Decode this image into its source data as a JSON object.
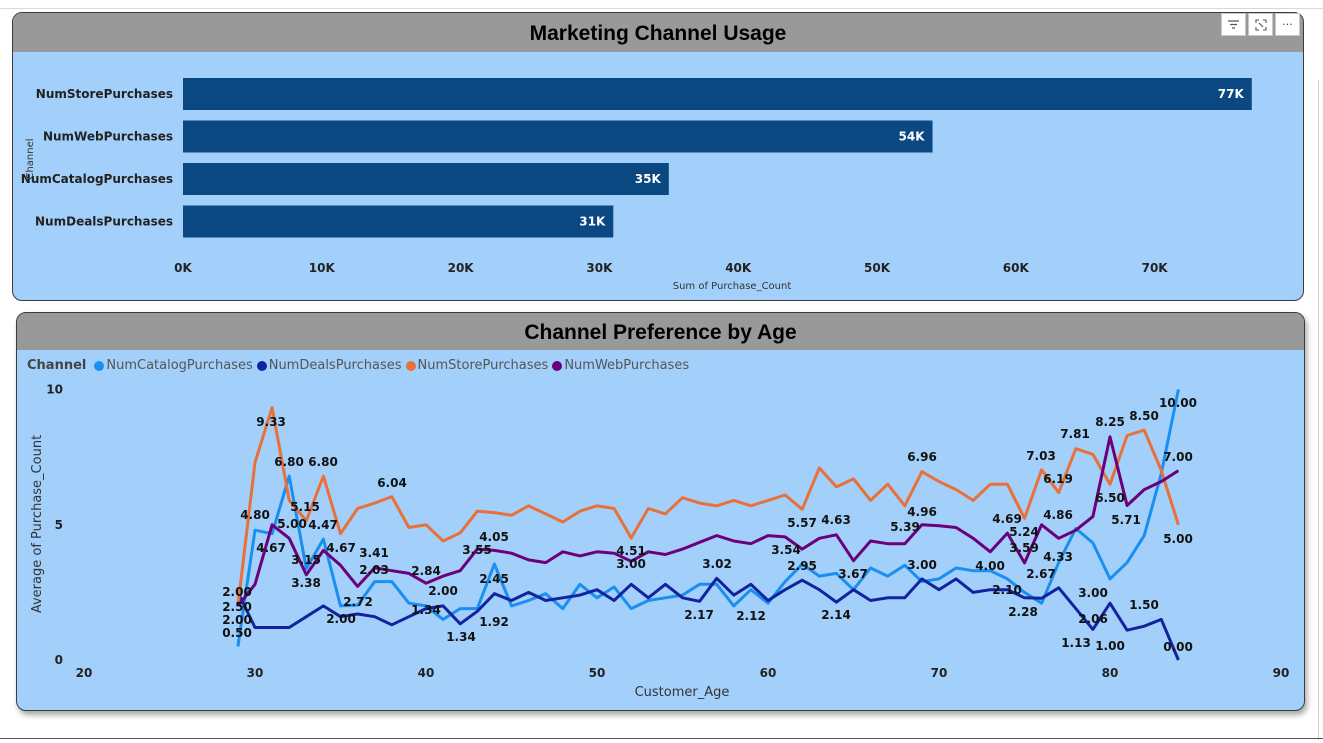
{
  "toolbar": {
    "filter_icon": "filter-icon",
    "focus_icon": "focus-mode-icon",
    "more_icon": "more-options-icon",
    "more_label": "···"
  },
  "colors": {
    "panel_bg": "#a3d0fb",
    "title_bar": "#999999",
    "bar": "#0b4780",
    "catalog": "#1a8ff0",
    "deals": "#12239e",
    "store": "#e8703a",
    "web": "#6b007b"
  },
  "chart_data": [
    {
      "type": "bar",
      "orientation": "horizontal",
      "title": "Marketing Channel Usage",
      "xlabel": "Sum of Purchase_Count",
      "ylabel": "Channel",
      "categories": [
        "NumStorePurchases",
        "NumWebPurchases",
        "NumCatalogPurchases",
        "NumDealsPurchases"
      ],
      "values": [
        77000,
        54000,
        35000,
        31000
      ],
      "data_labels": [
        "77K",
        "54K",
        "35K",
        "31K"
      ],
      "xlim": [
        0,
        77000
      ],
      "x_ticks": [
        0,
        10000,
        20000,
        30000,
        40000,
        50000,
        60000,
        70000
      ],
      "x_tick_labels": [
        "0K",
        "10K",
        "20K",
        "30K",
        "40K",
        "50K",
        "60K",
        "70K"
      ]
    },
    {
      "type": "line",
      "title": "Channel Preference by Age",
      "xlabel": "Customer_Age",
      "ylabel": "Average of Purchase_Count",
      "legend_title": "Channel",
      "xlim": [
        20,
        90
      ],
      "ylim": [
        0,
        10
      ],
      "x_ticks": [
        20,
        30,
        40,
        50,
        60,
        70,
        80,
        90
      ],
      "y_ticks": [
        0,
        5,
        10
      ],
      "x": [
        29,
        30,
        31,
        32,
        33,
        34,
        35,
        36,
        37,
        38,
        39,
        40,
        41,
        42,
        43,
        44,
        45,
        46,
        47,
        48,
        49,
        50,
        51,
        52,
        53,
        54,
        55,
        56,
        57,
        58,
        59,
        60,
        61,
        62,
        63,
        64,
        65,
        66,
        67,
        68,
        69,
        70,
        71,
        72,
        73,
        74,
        75,
        76,
        77,
        78,
        79,
        80,
        81,
        82,
        83,
        84
      ],
      "series": [
        {
          "name": "NumCatalogPurchases",
          "color": "#1a8ff0",
          "values": [
            0.5,
            4.8,
            4.67,
            6.8,
            3.38,
            4.47,
            2.0,
            2.03,
            2.9,
            2.9,
            2.1,
            2.0,
            1.5,
            1.9,
            1.9,
            3.55,
            2.0,
            2.2,
            2.45,
            1.9,
            2.8,
            2.3,
            2.7,
            1.9,
            2.2,
            2.3,
            2.4,
            2.8,
            2.8,
            2.0,
            2.6,
            2.1,
            2.9,
            3.54,
            3.1,
            3.2,
            2.6,
            3.4,
            3.1,
            3.5,
            2.9,
            3.0,
            3.4,
            3.3,
            3.3,
            3.0,
            2.5,
            2.1,
            3.6,
            4.86,
            4.33,
            3.0,
            3.6,
            4.6,
            6.9,
            10.0
          ]
        },
        {
          "name": "NumDealsPurchases",
          "color": "#12239e",
          "values": [
            2.5,
            1.2,
            1.2,
            1.2,
            1.6,
            2.0,
            1.6,
            1.7,
            1.6,
            1.3,
            1.6,
            1.9,
            2.0,
            1.34,
            1.8,
            2.45,
            2.2,
            2.5,
            2.2,
            2.3,
            2.4,
            2.6,
            2.2,
            2.8,
            2.3,
            2.8,
            2.3,
            2.17,
            3.02,
            2.4,
            2.8,
            2.2,
            2.6,
            2.95,
            2.6,
            2.14,
            2.6,
            2.2,
            2.3,
            2.3,
            3.0,
            2.6,
            3.0,
            2.5,
            2.6,
            2.6,
            2.3,
            2.28,
            2.67,
            1.9,
            1.13,
            2.1,
            1.1,
            1.25,
            1.5,
            0.0
          ]
        },
        {
          "name": "NumStorePurchases",
          "color": "#e8703a",
          "values": [
            2.0,
            7.3,
            9.33,
            5.9,
            5.15,
            6.8,
            4.67,
            5.6,
            5.8,
            6.04,
            4.9,
            5.0,
            4.4,
            4.7,
            5.5,
            5.45,
            5.35,
            5.7,
            5.4,
            5.1,
            5.5,
            5.7,
            5.6,
            4.51,
            5.6,
            5.4,
            6.0,
            5.8,
            5.7,
            5.9,
            5.7,
            5.9,
            6.1,
            5.57,
            7.1,
            6.4,
            6.7,
            5.9,
            6.5,
            5.7,
            6.96,
            6.6,
            6.3,
            5.9,
            6.5,
            6.5,
            5.24,
            7.03,
            6.19,
            7.81,
            7.6,
            6.5,
            8.3,
            8.5,
            7.0,
            5.0
          ]
        },
        {
          "name": "NumWebPurchases",
          "color": "#6b007b",
          "values": [
            2.0,
            2.8,
            5.0,
            4.5,
            3.15,
            4.05,
            3.5,
            2.72,
            3.41,
            3.3,
            3.2,
            2.84,
            3.1,
            3.3,
            4.1,
            4.05,
            3.95,
            3.7,
            3.6,
            4.0,
            3.85,
            4.0,
            3.95,
            3.65,
            4.0,
            3.9,
            4.1,
            4.35,
            4.6,
            4.4,
            4.3,
            4.6,
            4.55,
            4.1,
            4.5,
            4.63,
            3.67,
            4.4,
            4.3,
            4.3,
            5.0,
            4.96,
            4.9,
            4.5,
            4.0,
            4.69,
            3.59,
            5.0,
            4.5,
            4.8,
            5.3,
            8.25,
            5.71,
            6.3,
            6.6,
            7.0
          ]
        }
      ],
      "data_labels": [
        "9.33",
        "6.80",
        "6.80",
        "5.15",
        "6.04",
        "4.80",
        "4.67",
        "5.00",
        "3.15",
        "4.47",
        "4.67",
        "3.38",
        "3.41",
        "2.03",
        "2.72",
        "2.00",
        "2.84",
        "2.00",
        "1.34",
        "1.34",
        "3.55",
        "4.05",
        "2.45",
        "1.92",
        "2.00",
        "2.50",
        "2.00",
        "0.50",
        "4.51",
        "3.00",
        "3.02",
        "2.17",
        "2.12",
        "3.54",
        "2.95",
        "5.57",
        "4.63",
        "3.67",
        "2.14",
        "6.96",
        "4.96",
        "5.39",
        "3.00",
        "4.00",
        "2.10",
        "2.28",
        "4.69",
        "5.24",
        "3.59",
        "2.67",
        "7.03",
        "6.19",
        "4.86",
        "4.33",
        "7.81",
        "3.00",
        "2.06",
        "1.13",
        "1.00",
        "8.25",
        "6.50",
        "5.71",
        "8.50",
        "1.50",
        "10.00",
        "7.00",
        "5.00",
        "0.00"
      ]
    }
  ]
}
